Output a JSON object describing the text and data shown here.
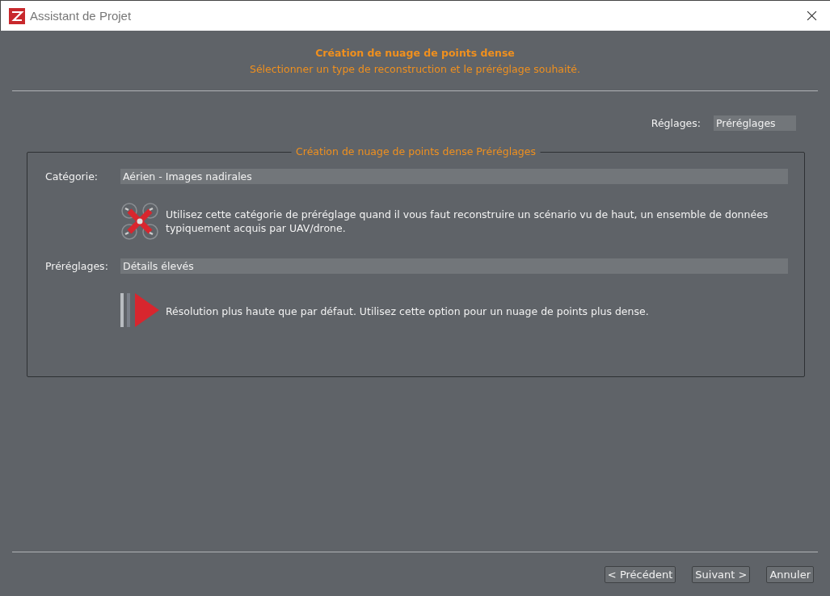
{
  "window": {
    "title": "Assistant de Projet"
  },
  "header": {
    "title": "Création de nuage de points dense",
    "subtitle": "Sélectionner un type de reconstruction et le préréglage souhaité."
  },
  "settings": {
    "label": "Réglages:",
    "value": "Préréglages"
  },
  "group": {
    "title": "Création de nuage de points dense Préréglages",
    "category": {
      "label": "Catégorie:",
      "value": "Aérien - Images nadirales",
      "description": "Utilisez cette catégorie de préréglage quand il vous faut reconstruire un scénario vu de haut, un ensemble de données typiquement acquis par UAV/drone."
    },
    "preset": {
      "label": "Préréglages:",
      "value": "Détails élevés",
      "description": "Résolution plus haute que par défaut. Utilisez cette option pour un nuage de points plus dense."
    }
  },
  "buttons": [
    "< Précédent",
    "Suivant >",
    "Annuler"
  ]
}
